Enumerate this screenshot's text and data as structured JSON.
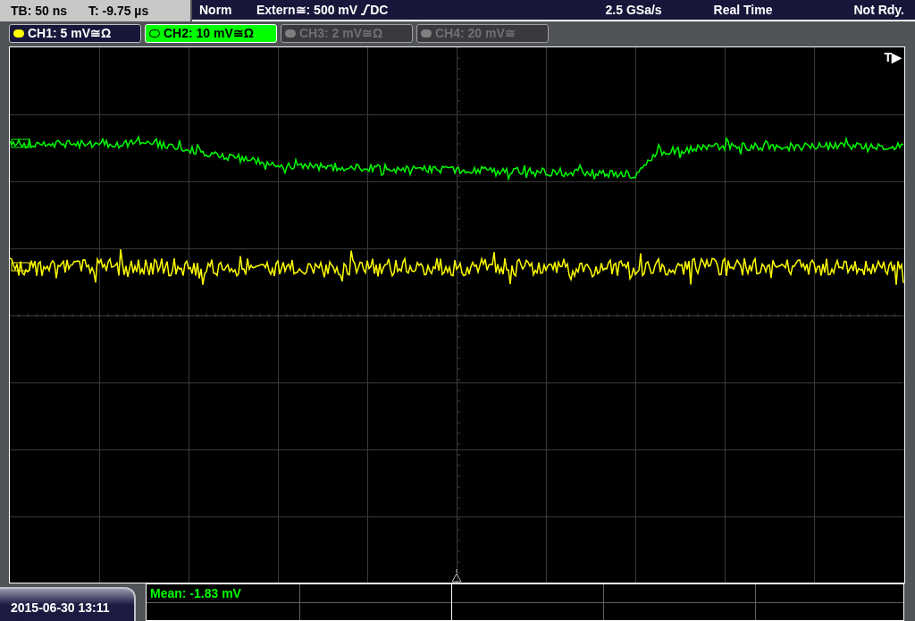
{
  "status_bar": {
    "timebase": "TB: 50 ns",
    "trigger_time": "T: -9.75 µs",
    "trigger_mode": "Norm",
    "trigger_source": "Extern≅: 500 mV",
    "trigger_coupling": "DC",
    "sample_rate": "2.5 GSa/s",
    "acquisition_mode": "Real Time",
    "trigger_state": "Not Rdy."
  },
  "channels": [
    {
      "label": "CH1: 5 mV≅Ω",
      "selected": false,
      "enabled": true,
      "color": "#ffff00"
    },
    {
      "label": "CH2: 10 mV≅Ω",
      "selected": true,
      "enabled": true,
      "color": "#00ff00"
    },
    {
      "label": "CH3: 2 mV≅Ω",
      "selected": false,
      "enabled": false,
      "color": "#808080"
    },
    {
      "label": "CH4: 20 mV≅",
      "selected": false,
      "enabled": false,
      "color": "#808080"
    }
  ],
  "trigger_marker": "T▶",
  "date_time": "2015-06-30 13:11",
  "measurements": [
    {
      "text": "Mean: -1.83 mV",
      "color": "#00ff00"
    }
  ]
}
